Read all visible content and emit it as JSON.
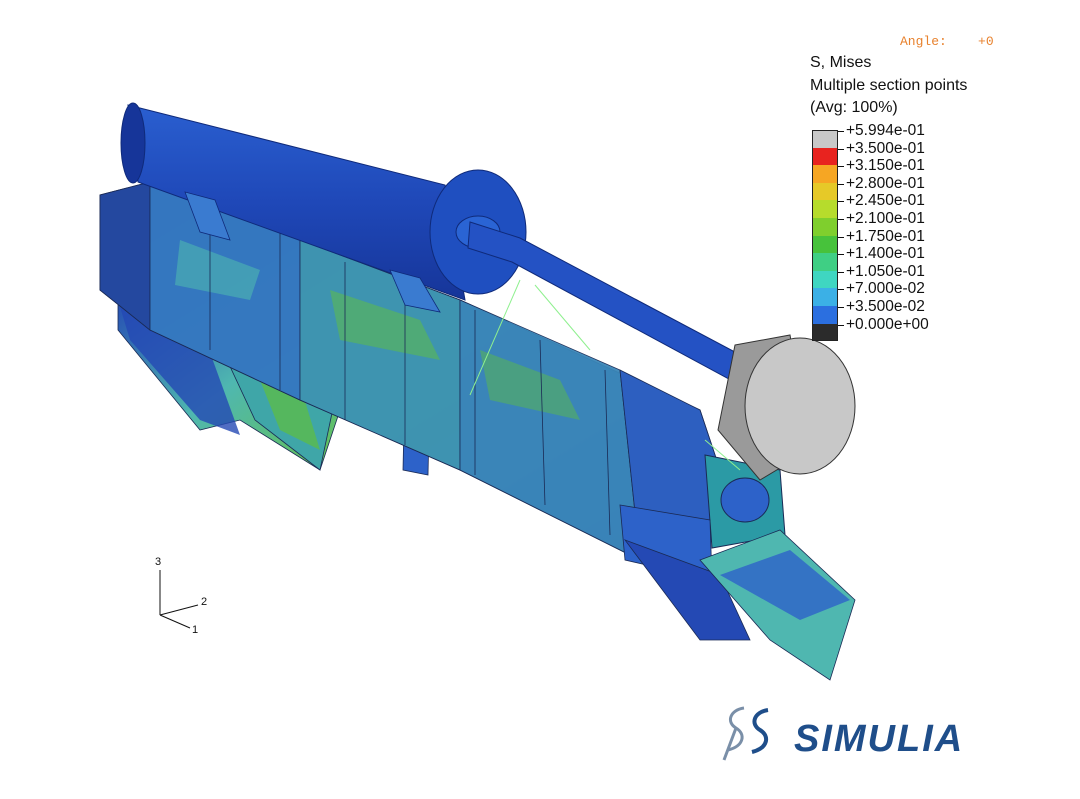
{
  "viewport": {
    "angle_label": "Angle:",
    "angle_value": "+0"
  },
  "legend": {
    "variable": "S, Mises",
    "section": "Multiple section points",
    "averaging": "(Avg: 100%)",
    "entries": [
      {
        "value": "+5.994e-01",
        "color": "#c8c8c8"
      },
      {
        "value": "+3.500e-01",
        "color": "#e8231f"
      },
      {
        "value": "+3.150e-01",
        "color": "#f6a623"
      },
      {
        "value": "+2.800e-01",
        "color": "#e6c928"
      },
      {
        "value": "+2.450e-01",
        "color": "#b6dc2c"
      },
      {
        "value": "+2.100e-01",
        "color": "#7fcf2d"
      },
      {
        "value": "+1.750e-01",
        "color": "#47c23b"
      },
      {
        "value": "+1.400e-01",
        "color": "#3fcf84"
      },
      {
        "value": "+1.050e-01",
        "color": "#3fd6c1"
      },
      {
        "value": "+7.000e-02",
        "color": "#3bb0e6"
      },
      {
        "value": "+3.500e-02",
        "color": "#2b6fe0"
      },
      {
        "value": "+0.000e+00",
        "color": "#2b2b2b"
      }
    ]
  },
  "triad": {
    "axis3": "3",
    "axis2": "2",
    "axis1": "1"
  },
  "brand": {
    "name": "SIMULIA"
  },
  "colors": {
    "model_dark_blue": "#1b3fa8",
    "model_mid_blue": "#2d62c9",
    "model_cyan": "#4fb7b0",
    "model_green": "#5fbf3e",
    "impactor_gray": "#c8c8c8",
    "angle_orange": "#e8822e"
  }
}
